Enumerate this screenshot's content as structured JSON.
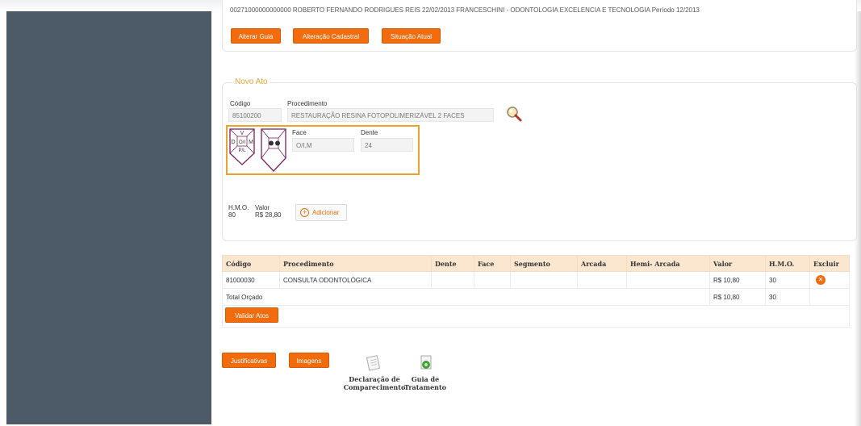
{
  "top_row_text": "00271000000000000 ROBERTO FERNANDO RODRIGUES REIS 22/02/2013 FRANCESCHINI - ODONTOLOGIA EXCELENCIA E TECNOLOGIA Período 12/2013",
  "top_buttons": {
    "alterar_guia": "Alterar Guia",
    "alteracao_cadastral": "Alteração Cadastral",
    "situacao_atual": "Situação Atual"
  },
  "novo_ato": {
    "legend": "Novo Ato",
    "codigo_label": "Código",
    "codigo_value": "85100200",
    "procedimento_label": "Procedimento",
    "procedimento_value": "RESTAURAÇÃO RESINA FOTOPOLIMERIZÁVEL 2 FACES",
    "face_label": "Face",
    "face_value": "O/I,M",
    "dente_label": "Dente",
    "dente_value": "24",
    "tooth_letters": [
      "V",
      "D",
      "O/I",
      "M",
      "P/L"
    ],
    "hmo_label": "H.M.O.",
    "hmo_value": "80",
    "valor_label": "Valor",
    "valor_value": "R$ 28,80",
    "adicionar": "Adicionar"
  },
  "table": {
    "headers": [
      "Código",
      "Procedimento",
      "Dente",
      "Face",
      "Segmento",
      "Arcada",
      "Hemi- Arcada",
      "Valor",
      "H.M.O.",
      "Excluir"
    ],
    "rows": [
      {
        "codigo": "81000030",
        "procedimento": "CONSULTA ODONTOLÓGICA",
        "dente": "",
        "face": "",
        "segmento": "",
        "arcada": "",
        "hemi_arcada": "",
        "valor": "R$ 10,80",
        "hmo": "30"
      }
    ],
    "total_label": "Total Orçado",
    "total_valor": "R$ 10,80",
    "total_hmo": "30"
  },
  "validar_atos": "Validar Atos",
  "bottom": {
    "justificativas": "Justificativas",
    "imagens": "Imagens",
    "declaracao_l1": "Declaração de",
    "declaracao_l2": "Comparecimento",
    "guia_l1": "Guia de",
    "guia_l2": "Tratamento"
  },
  "colors": {
    "accent": "#f26c0d",
    "sidebar": "#4d5b69",
    "highlight_border": "#f0a030",
    "header_bg": "#fbe6cf",
    "legend": "#e8a23a",
    "tooth_stroke": "#7a2060"
  }
}
